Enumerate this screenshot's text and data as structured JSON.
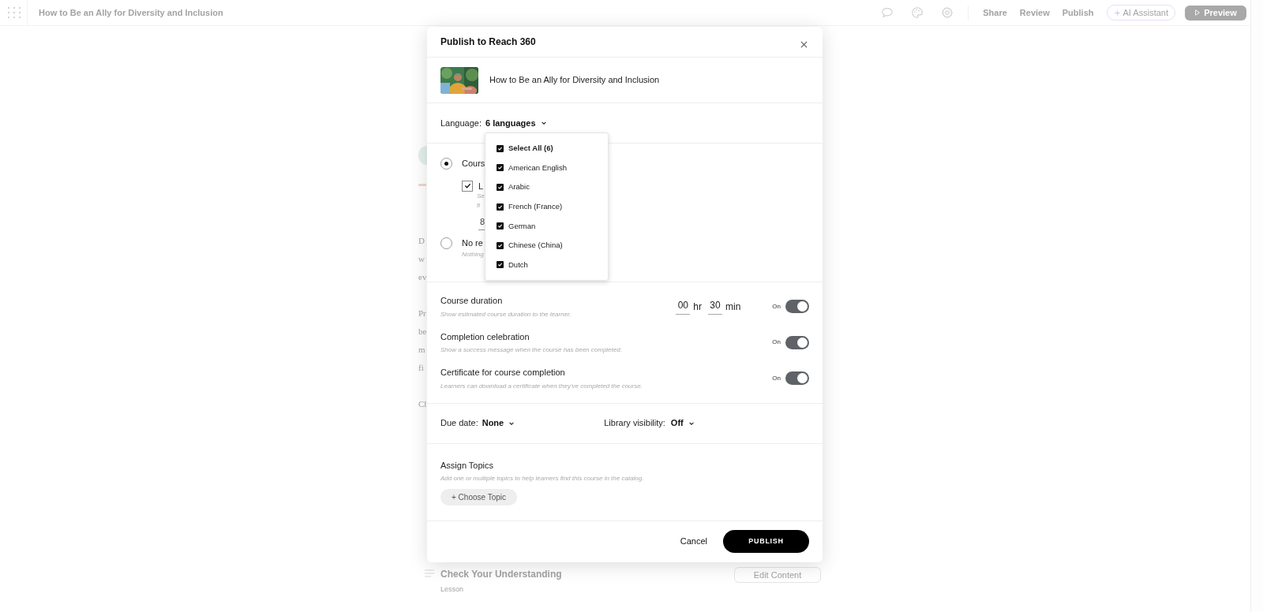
{
  "top_bar": {
    "title": "How to Be an Ally for Diversity and Inclusion",
    "links": [
      "Share",
      "Review",
      "Publish"
    ],
    "ai_button": "AI Assistant",
    "preview_button": "Preview"
  },
  "background": {
    "paragraphs": [
      [
        "D",
        "w",
        "ev"
      ],
      [
        "Pr",
        "be",
        "m",
        "fi"
      ],
      [
        "Cl"
      ]
    ],
    "lesson": {
      "title": "Check Your Understanding",
      "subtitle": "Lesson",
      "button": "Edit Content"
    }
  },
  "dialog": {
    "title": "Publish to Reach 360",
    "course": {
      "title": "How to Be an Ally for Diversity and Inclusion"
    },
    "language": {
      "label": "Language:",
      "value": "6 languages",
      "expanded": true
    },
    "language_menu": [
      {
        "label": "Select All (6)",
        "checked": true,
        "kind": "all"
      },
      {
        "label": "American English",
        "checked": true,
        "kind": "language"
      },
      {
        "label": "Arabic",
        "checked": true,
        "kind": "language"
      },
      {
        "label": "French (France)",
        "checked": true,
        "kind": "language"
      },
      {
        "label": "German",
        "checked": true,
        "kind": "language"
      },
      {
        "label": "Chinese (China)",
        "checked": true,
        "kind": "language"
      },
      {
        "label": "Dutch",
        "checked": true,
        "kind": "language"
      }
    ],
    "completion_options": [
      {
        "label": "Cours",
        "selected": true,
        "sub_option": {
          "label": "L",
          "checked": true,
          "hint_lines": [
            "Se",
            "fi"
          ],
          "value": "8"
        }
      },
      {
        "label": "No re",
        "hint": "Nothing",
        "selected": false
      }
    ],
    "settings": [
      {
        "title": "Course duration",
        "hint": "Show estimated course duration to the learner.",
        "duration": {
          "hours": "00",
          "hours_unit": "hr",
          "minutes": "30",
          "minutes_unit": "min"
        },
        "state_label": "On",
        "on": true
      },
      {
        "title": "Completion celebration",
        "hint": "Show a success message when the course has been completed.",
        "state_label": "On",
        "on": true
      },
      {
        "title": "Certificate for course completion",
        "hint": "Learners can download a certificate when they've completed the course.",
        "state_label": "On",
        "on": true
      }
    ],
    "due_date": {
      "label": "Due date:",
      "value": "None"
    },
    "library_visibility": {
      "label": "Library visibility:",
      "value": "Off"
    },
    "topics": {
      "title": "Assign Topics",
      "hint": "Add one or multiple topics to help learners find this course in the catalog.",
      "button": "+ Choose Topic"
    },
    "footer": {
      "cancel": "Cancel",
      "publish": "PUBLISH"
    }
  }
}
